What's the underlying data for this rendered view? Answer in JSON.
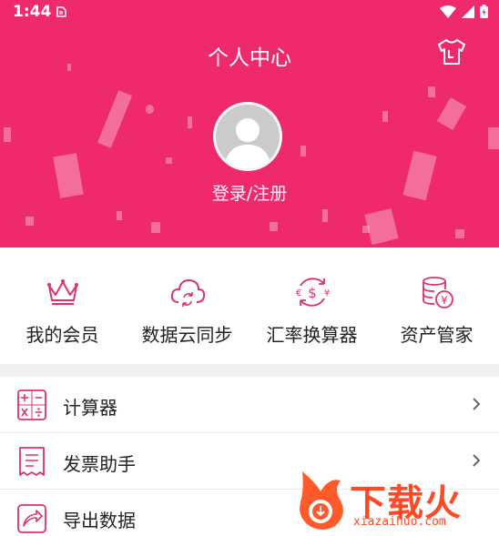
{
  "status_bar": {
    "time": "1:44"
  },
  "header": {
    "title": "个人中心",
    "login_label": "登录/注册",
    "background_color": "#ee2a6b",
    "icons": {
      "theme": "tshirt-icon",
      "avatar": "user-avatar-icon"
    }
  },
  "quick_actions": [
    {
      "label": "我的会员",
      "icon": "crown-icon"
    },
    {
      "label": "数据云同步",
      "icon": "cloud-sync-icon"
    },
    {
      "label": "汇率换算器",
      "icon": "currency-exchange-icon"
    },
    {
      "label": "资产管家",
      "icon": "coins-icon"
    }
  ],
  "menu": [
    {
      "label": "计算器",
      "icon": "calculator-icon"
    },
    {
      "label": "发票助手",
      "icon": "receipt-icon"
    },
    {
      "label": "导出数据",
      "icon": "export-icon"
    }
  ],
  "watermark": {
    "brand": "下载火",
    "url": "xiazaihuo.com"
  },
  "accent_color": "#e0306f"
}
